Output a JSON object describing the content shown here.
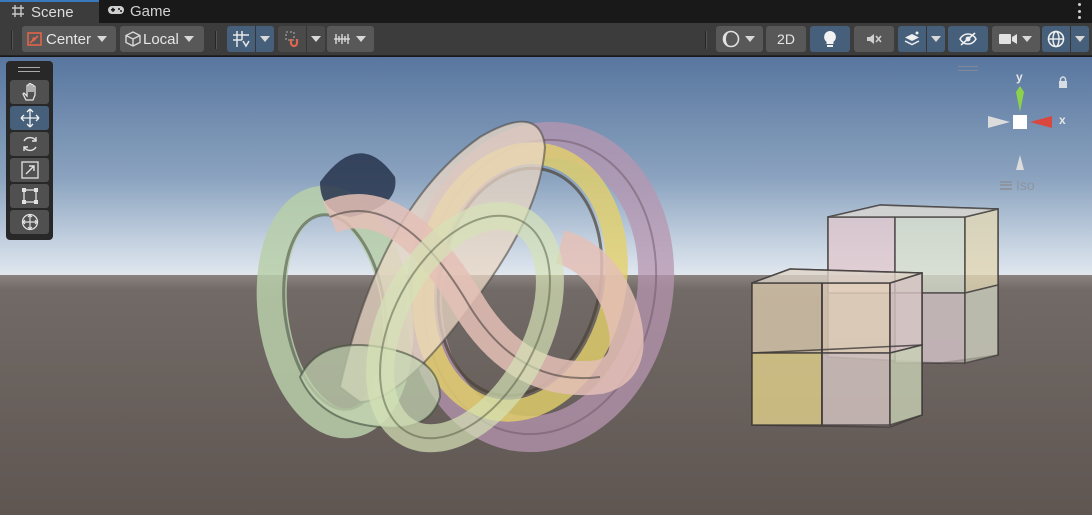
{
  "tabs": [
    {
      "label": "Scene",
      "icon": "grid-icon",
      "active": true
    },
    {
      "label": "Game",
      "icon": "gamepad-icon",
      "active": false
    }
  ],
  "toolbar": {
    "pivot_mode": "Center",
    "pivot_rotation": "Local",
    "mode_2d": "2D"
  },
  "tools": [
    "hand-tool",
    "move-tool",
    "rotate-tool",
    "scale-tool",
    "rect-tool",
    "transform-tool"
  ],
  "gizmo": {
    "y_label": "y",
    "x_label": "x",
    "projection": "Iso",
    "colors": {
      "x": "#d9473e",
      "y": "#8cd14a",
      "neutral": "#d4d4d4"
    }
  },
  "colors": {
    "accent": "#46607c",
    "tab_highlight": "#3a79bb",
    "sky_top": "#5a78a3",
    "horizon": "#cfd9e5",
    "ground": "#6c6560"
  }
}
